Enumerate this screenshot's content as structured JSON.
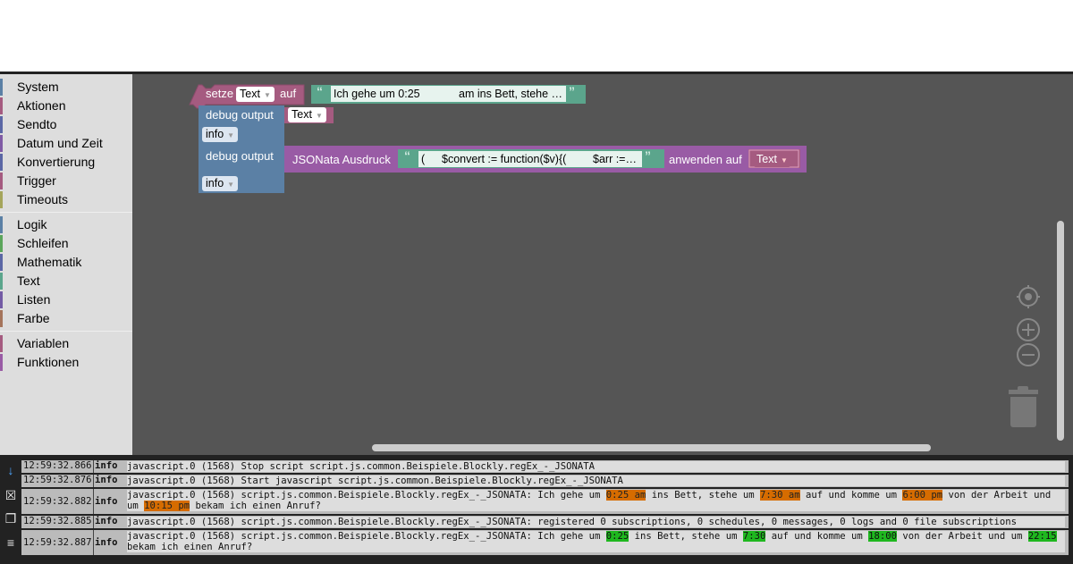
{
  "toolbox": {
    "items": [
      {
        "label": "System",
        "color": "#5b80a5"
      },
      {
        "label": "Aktionen",
        "color": "#a55b80"
      },
      {
        "label": "Sendto",
        "color": "#5b67a5"
      },
      {
        "label": "Datum und Zeit",
        "color": "#805ba5"
      },
      {
        "label": "Konvertierung",
        "color": "#5b67a5"
      },
      {
        "label": "Trigger",
        "color": "#a55b80"
      },
      {
        "label": "Timeouts",
        "color": "#a5a55b"
      },
      {
        "label": "Logik",
        "color": "#5b80a5"
      },
      {
        "label": "Schleifen",
        "color": "#5ba55b"
      },
      {
        "label": "Mathematik",
        "color": "#5b67a5"
      },
      {
        "label": "Text",
        "color": "#5ba58c"
      },
      {
        "label": "Listen",
        "color": "#745ba5"
      },
      {
        "label": "Farbe",
        "color": "#a5745b"
      },
      {
        "label": "Variablen",
        "color": "#a55b80"
      },
      {
        "label": "Funktionen",
        "color": "#995ba5"
      }
    ]
  },
  "blocks": {
    "set": {
      "label": "setze",
      "var": "Text",
      "suffix": "auf",
      "text_a": "Ich gehe um 0:25",
      "text_b": "am ins Bett, stehe …"
    },
    "debug1": {
      "label": "debug output",
      "var": "Text",
      "level": "info"
    },
    "debug2": {
      "label": "debug output",
      "level": "info"
    },
    "jsonata": {
      "label": "JSONata Ausdruck",
      "expr_a": "(",
      "expr_b": "$convert := function($v){(",
      "expr_c": "$arr :=…",
      "apply": "anwenden auf",
      "var": "Text"
    }
  },
  "log": [
    {
      "time": "12:59:32.866",
      "level": "info",
      "msg": "javascript.0 (1568) Stop script script.js.common.Beispiele.Blockly.regEx_-_JSONATA"
    },
    {
      "time": "12:59:32.876",
      "level": "info",
      "msg": "javascript.0 (1568) Start javascript script.js.common.Beispiele.Blockly.regEx_-_JSONATA"
    },
    {
      "time": "12:59:32.882",
      "level": "info",
      "msg_parts": [
        "javascript.0 (1568) script.js.common.Beispiele.Blockly.regEx_-_JSONATA: Ich gehe um ",
        "0:25 am",
        " ins Bett, stehe um ",
        "7:30 am",
        " auf und komme um ",
        "6:00 pm",
        " von der Arbeit und um ",
        "10:15 pm",
        " bekam ich einen Anruf?"
      ]
    },
    {
      "time": "12:59:32.885",
      "level": "info",
      "msg": "javascript.0 (1568) script.js.common.Beispiele.Blockly.regEx_-_JSONATA: registered 0 subscriptions, 0 schedules, 0 messages, 0 logs and 0 file subscriptions"
    },
    {
      "time": "12:59:32.887",
      "level": "info",
      "msg_parts": [
        "javascript.0 (1568) script.js.common.Beispiele.Blockly.regEx_-_JSONATA: Ich gehe um ",
        "0:25",
        " ins Bett, stehe um ",
        "7:30",
        " auf und komme um ",
        "18:00",
        " von der Arbeit und um ",
        "22:15",
        " bekam ich einen Anruf?"
      ]
    }
  ],
  "icons": [
    "scroll-down-icon",
    "clear-log-icon",
    "copy-icon",
    "log-list-icon",
    "recenter-icon",
    "zoom-in-icon",
    "zoom-out-icon",
    "trash-icon"
  ]
}
